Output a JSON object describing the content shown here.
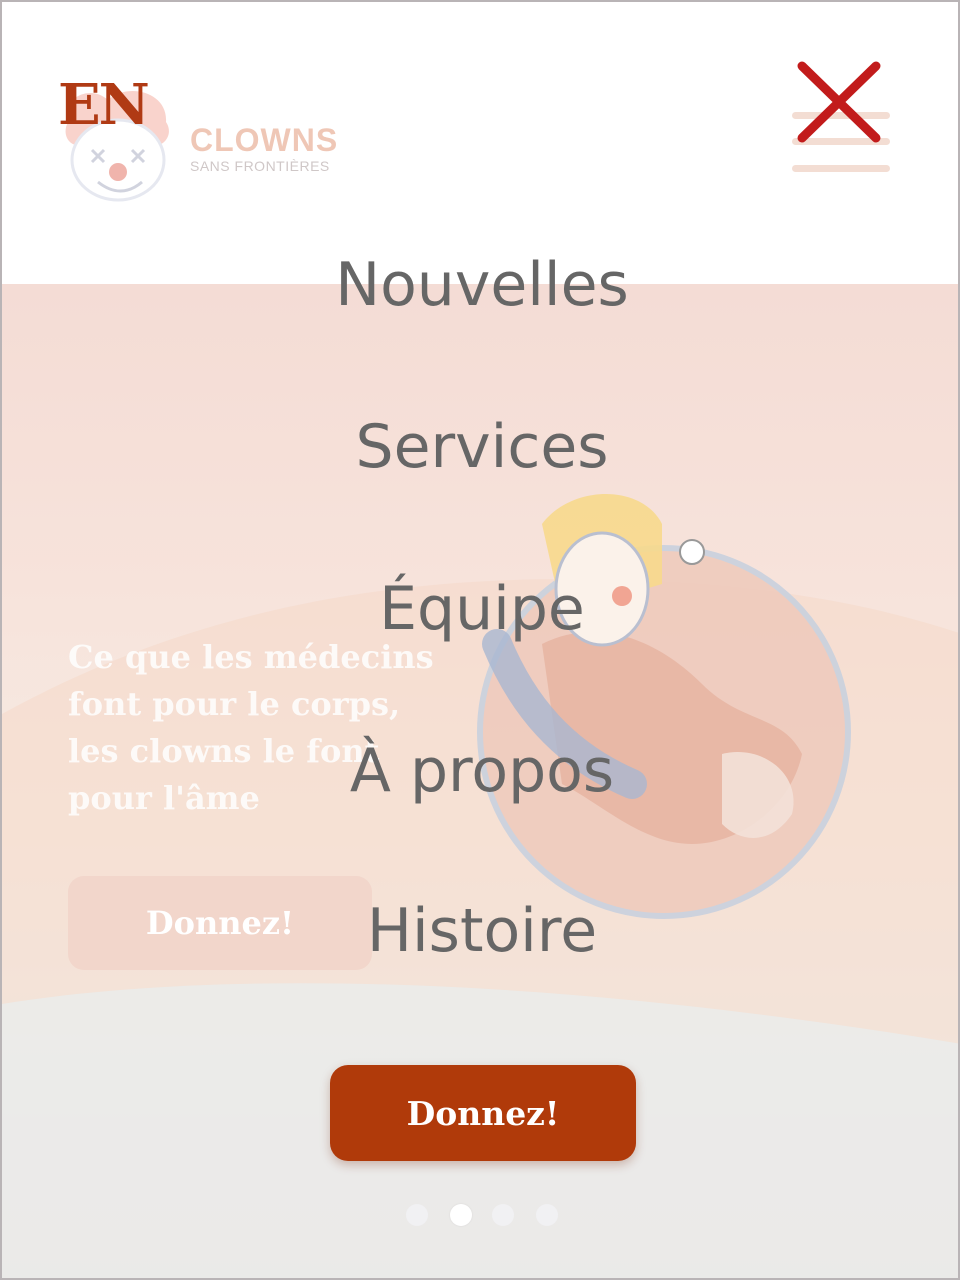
{
  "header": {
    "language_toggle": "EN",
    "logo_title": "CLOWNS",
    "logo_subtitle": "SANS FRONTIÈRES"
  },
  "menu": {
    "items": [
      {
        "label": "Nouvelles"
      },
      {
        "label": "Services"
      },
      {
        "label": "Équipe"
      },
      {
        "label": "À propos"
      },
      {
        "label": "Histoire"
      }
    ]
  },
  "hero": {
    "slogan_lines": [
      "Ce que les médecins",
      "font pour le corps,",
      "les clowns le font",
      "pour l'âme"
    ],
    "donate_label": "Donnez!"
  },
  "donate_button": {
    "label": "Donnez!"
  },
  "carousel": {
    "slide_count": 4,
    "active_index": 1
  },
  "colors": {
    "accent": "#b03a0a",
    "language_toggle": "#b03a14",
    "close_icon": "#c21b1b",
    "menu_text": "#666666"
  },
  "icons": {
    "close": "close-x-icon",
    "menu": "hamburger-menu-icon",
    "logo": "clown-face-logo"
  }
}
